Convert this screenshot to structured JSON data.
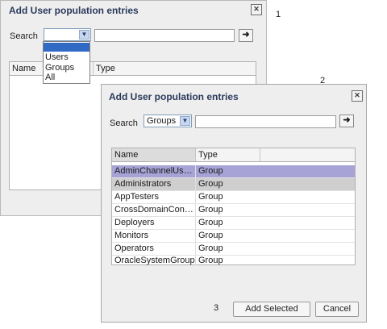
{
  "callouts": [
    "1",
    "2",
    "3"
  ],
  "dialog1": {
    "title": "Add User population entries",
    "search_label": "Search",
    "search_value": "",
    "dropdown_options": [
      "",
      "Users",
      "Groups",
      "All"
    ],
    "columns": [
      "Name",
      "Type"
    ]
  },
  "dialog2": {
    "title": "Add User population entries",
    "search_label": "Search",
    "search_value": "Groups",
    "columns": [
      "Name",
      "Type"
    ],
    "rows": [
      {
        "name": "AdminChannelUsers",
        "type": "Group"
      },
      {
        "name": "Administrators",
        "type": "Group"
      },
      {
        "name": "AppTesters",
        "type": "Group"
      },
      {
        "name": "CrossDomainConn...",
        "type": "Group"
      },
      {
        "name": "Deployers",
        "type": "Group"
      },
      {
        "name": "Monitors",
        "type": "Group"
      },
      {
        "name": "Operators",
        "type": "Group"
      },
      {
        "name": "OracleSystemGroup",
        "type": "Group"
      }
    ],
    "add_selected_label": "Add Selected",
    "cancel_label": "Cancel"
  },
  "colors": {
    "title": "#2b3a5c",
    "selected_row": "#a7a3d6",
    "secondary_selected_row": "#cfcfcf",
    "highlight_option": "#316ac5"
  },
  "icons": {
    "close": "close-icon",
    "dropdown": "chevron-down-icon",
    "go": "arrow-right-icon"
  }
}
